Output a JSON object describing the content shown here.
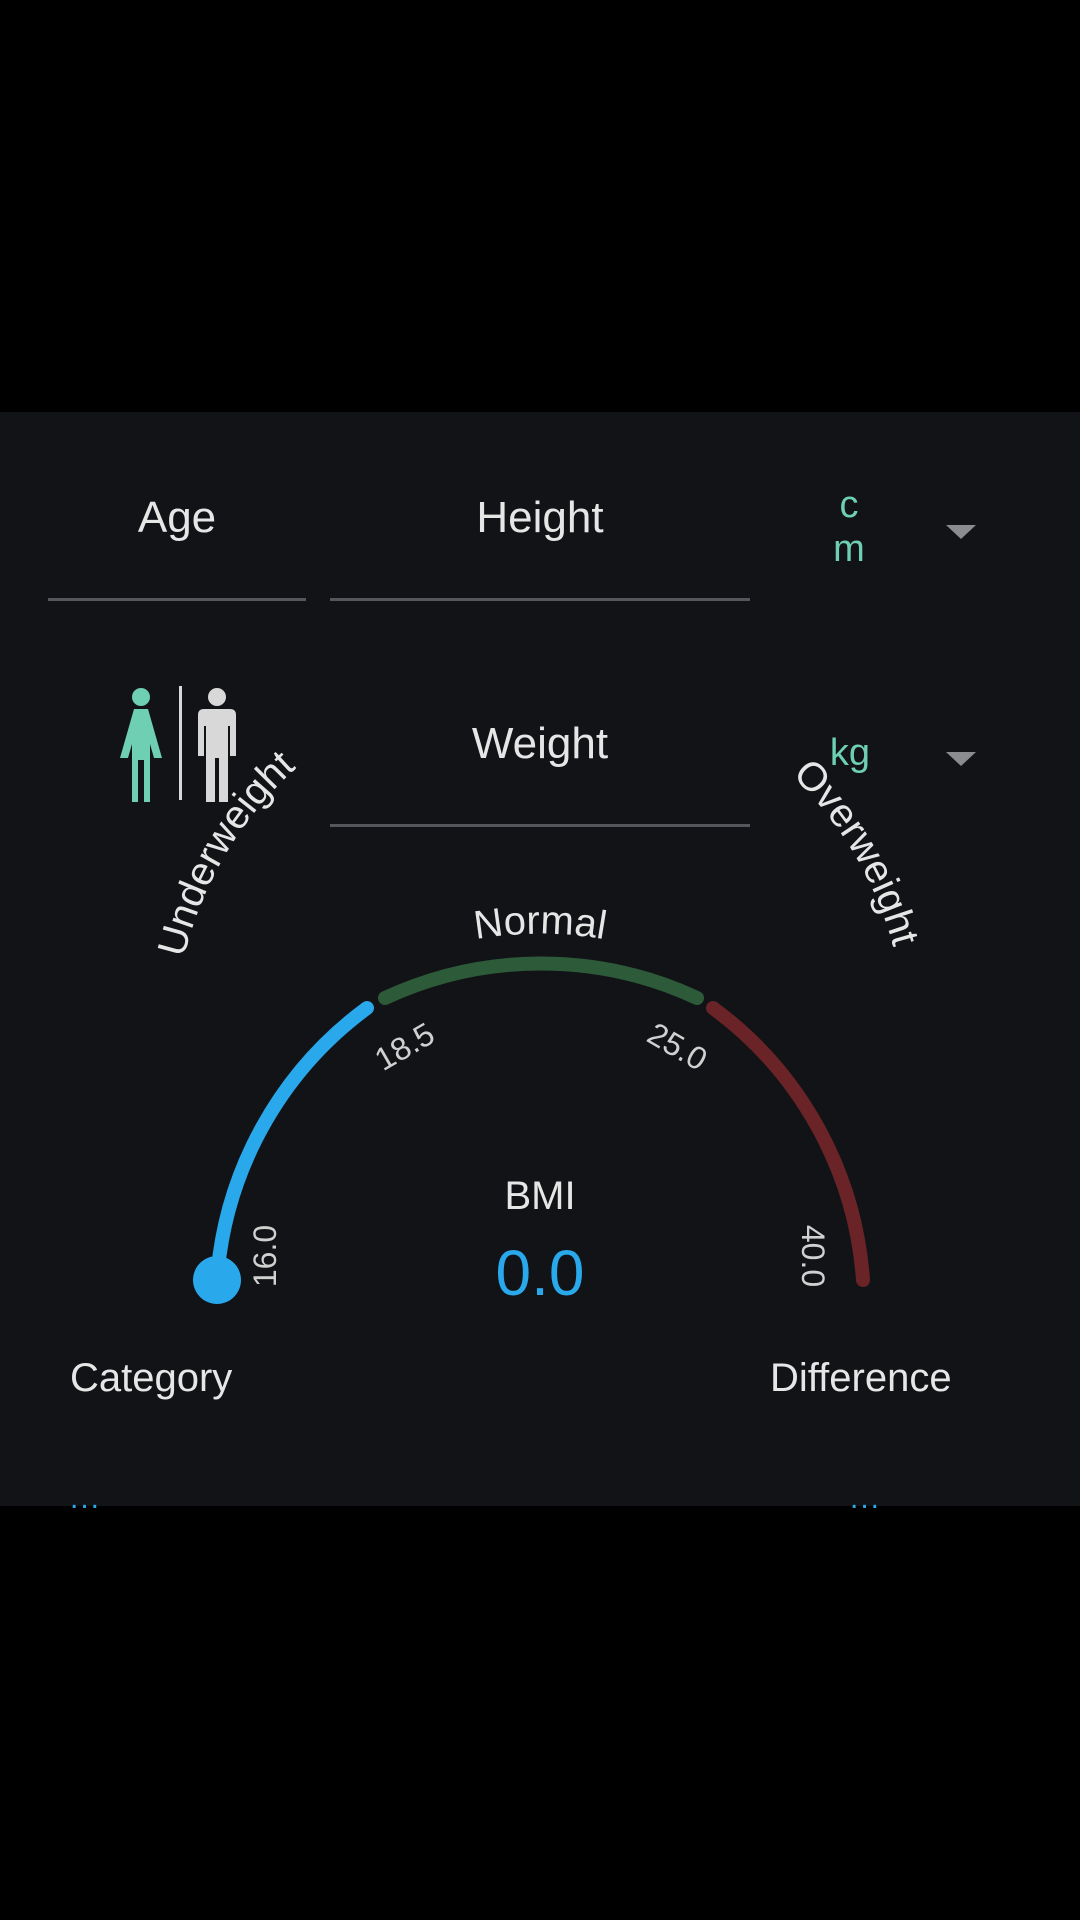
{
  "inputs": {
    "age_label": "Age",
    "height_label": "Height",
    "height_unit": "cm",
    "weight_label": "Weight",
    "weight_unit": "kg"
  },
  "gender": {
    "selected": "female",
    "female_icon": "female-figure-icon",
    "male_icon": "male-figure-icon"
  },
  "gauge": {
    "bmi_label": "BMI",
    "bmi_value": "0.0",
    "categories": {
      "underweight": "Underweight",
      "normal": "Normal",
      "overweight": "Overweight"
    },
    "ticks": [
      "16.0",
      "18.5",
      "25.0",
      "40.0"
    ],
    "progress": 0.0
  },
  "results": {
    "category_label": "Category",
    "category_value": "...",
    "difference_label": "Difference",
    "difference_value": "..."
  },
  "colors": {
    "accent": "#2aa8ec",
    "teal": "#6fcfb2",
    "normal_band": "#2d5a38",
    "overweight_band": "#6a2428",
    "background": "#121316"
  }
}
